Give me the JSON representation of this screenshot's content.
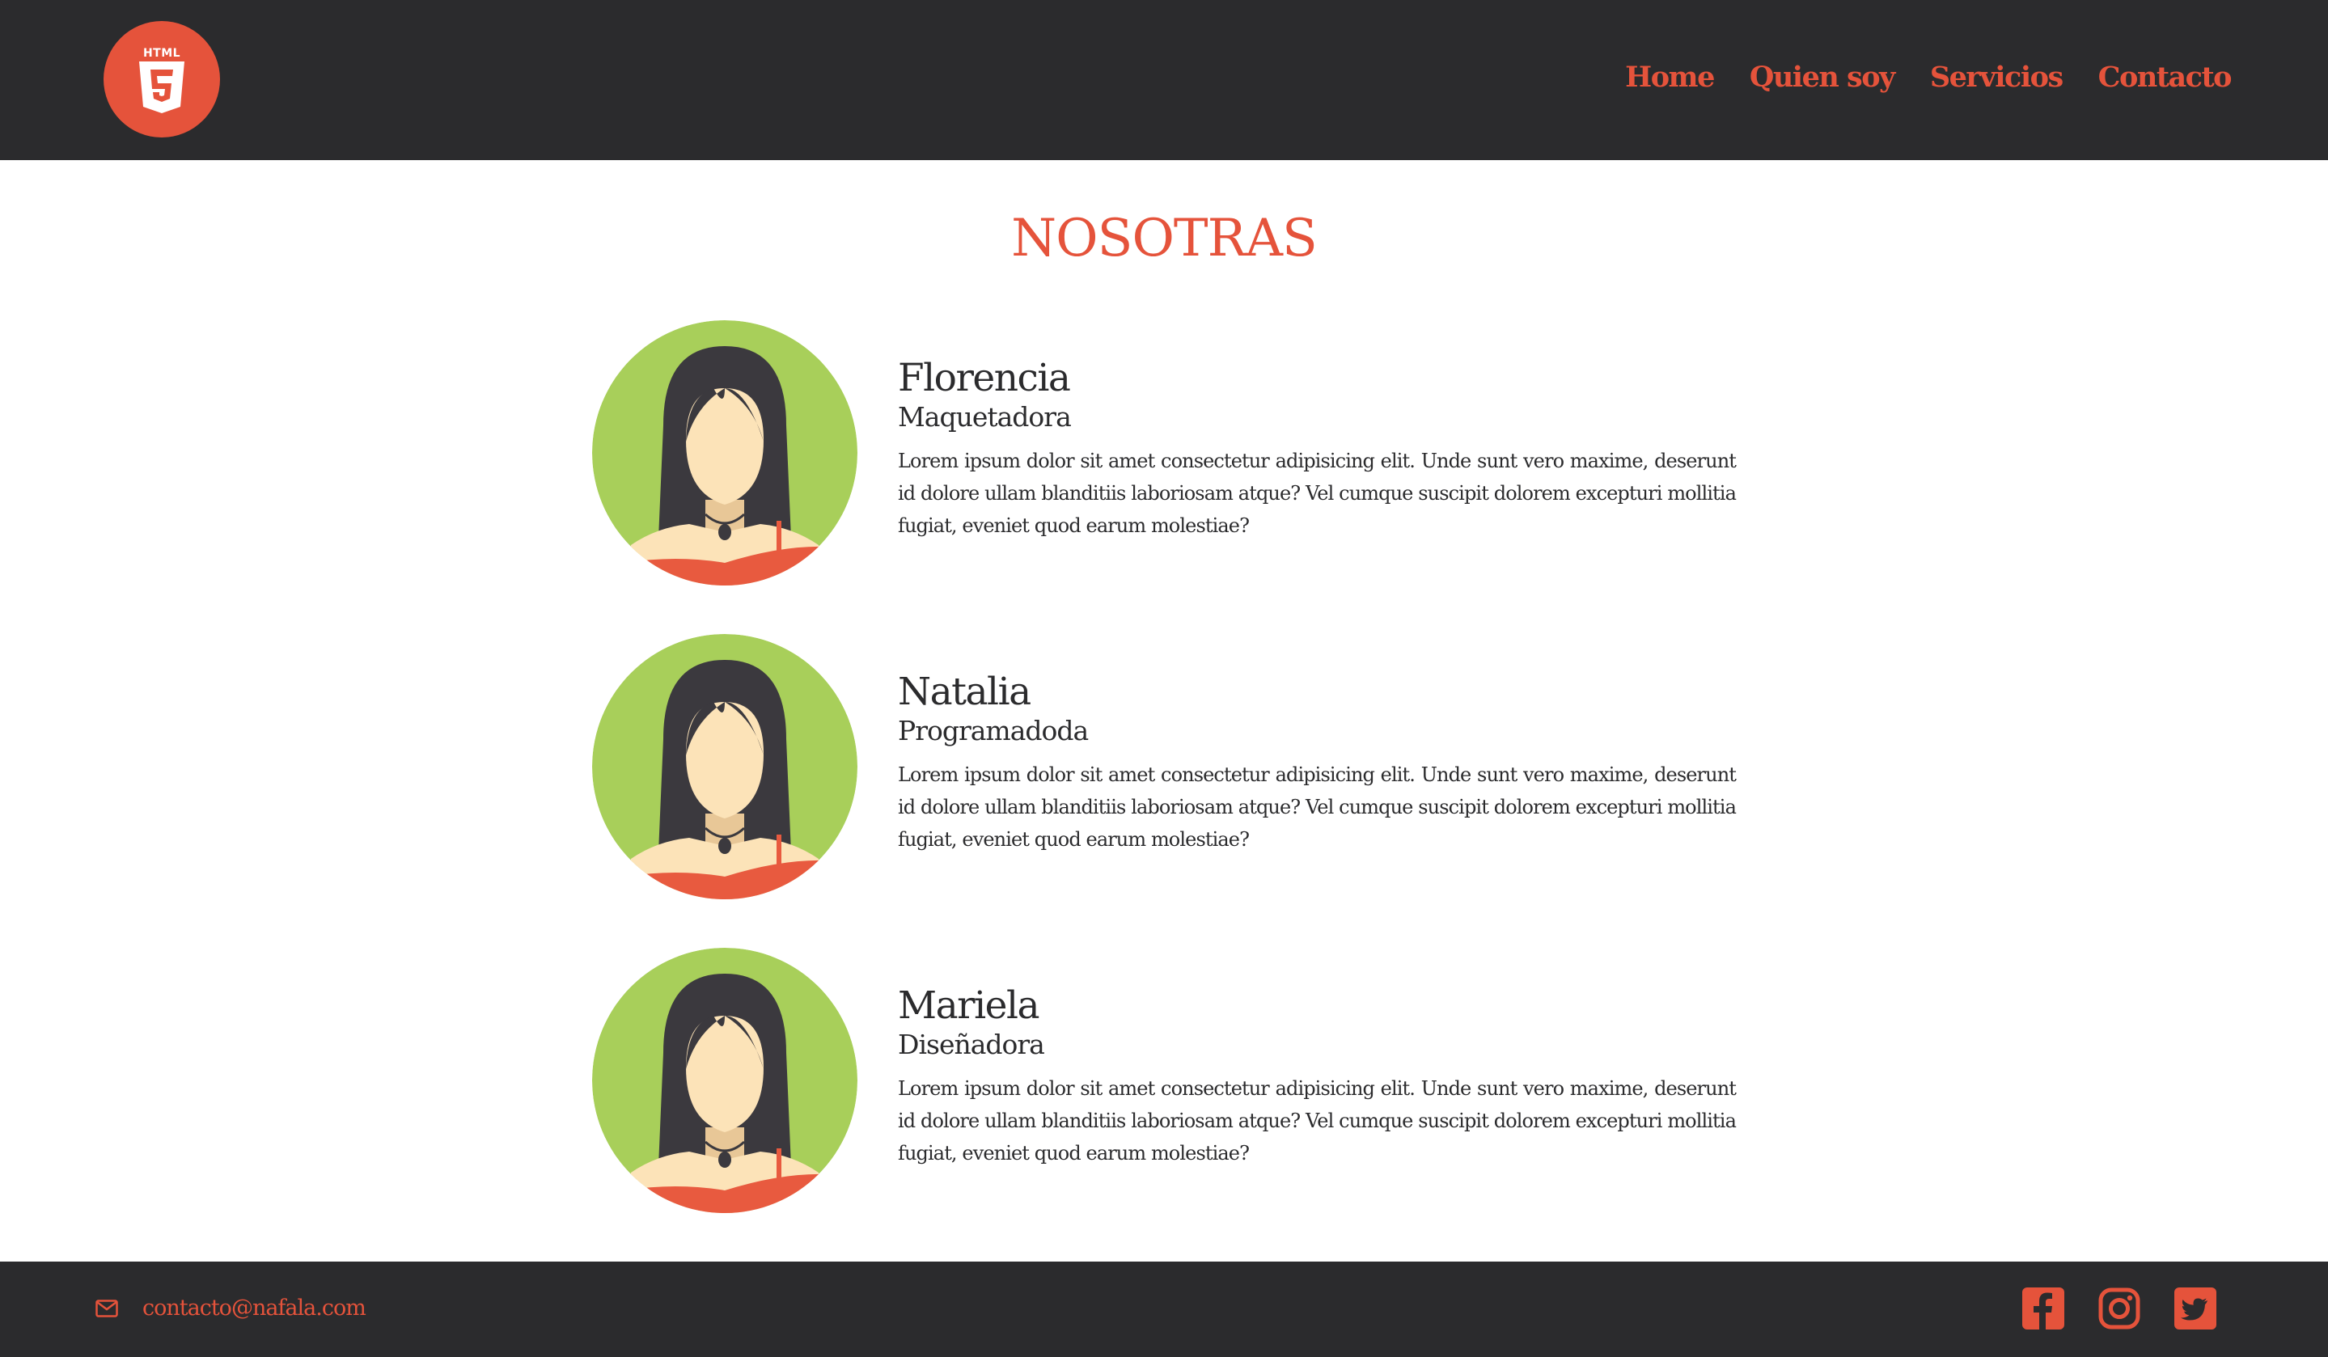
{
  "header": {
    "logo_icon": "html5-logo-icon",
    "nav": [
      {
        "label": "Home"
      },
      {
        "label": "Quien soy"
      },
      {
        "label": "Servicios"
      },
      {
        "label": "Contacto"
      }
    ]
  },
  "main": {
    "title": "NOSOTRAS",
    "members": [
      {
        "name": "Florencia",
        "role": "Maquetadora",
        "bio": "Lorem ipsum dolor sit amet consectetur adipisicing elit. Unde sunt vero maxime, deserunt id dolore ullam blanditiis laboriosam atque? Vel cumque suscipit dolorem excepturi mollitia fugiat, eveniet quod earum molestiae?",
        "avatar_icon": "woman-avatar-icon"
      },
      {
        "name": "Natalia",
        "role": "Programadoda",
        "bio": "Lorem ipsum dolor sit amet consectetur adipisicing elit. Unde sunt vero maxime, deserunt id dolore ullam blanditiis laboriosam atque? Vel cumque suscipit dolorem excepturi mollitia fugiat, eveniet quod earum molestiae?",
        "avatar_icon": "woman-avatar-icon"
      },
      {
        "name": "Mariela",
        "role": "Diseñadora",
        "bio": "Lorem ipsum dolor sit amet consectetur adipisicing elit. Unde sunt vero maxime, deserunt id dolore ullam blanditiis laboriosam atque? Vel cumque suscipit dolorem excepturi mollitia fugiat, eveniet quod earum molestiae?",
        "avatar_icon": "woman-avatar-icon"
      }
    ]
  },
  "footer": {
    "email": "contacto@nafala.com",
    "email_icon": "envelope-icon",
    "socials": [
      {
        "icon": "facebook-icon"
      },
      {
        "icon": "instagram-icon"
      },
      {
        "icon": "twitter-icon"
      }
    ]
  },
  "colors": {
    "accent": "#e5533b",
    "dark": "#2b2b2d",
    "avatar_bg": "#a8cf5a",
    "skin": "#fce3b8",
    "hair": "#3b393e"
  }
}
